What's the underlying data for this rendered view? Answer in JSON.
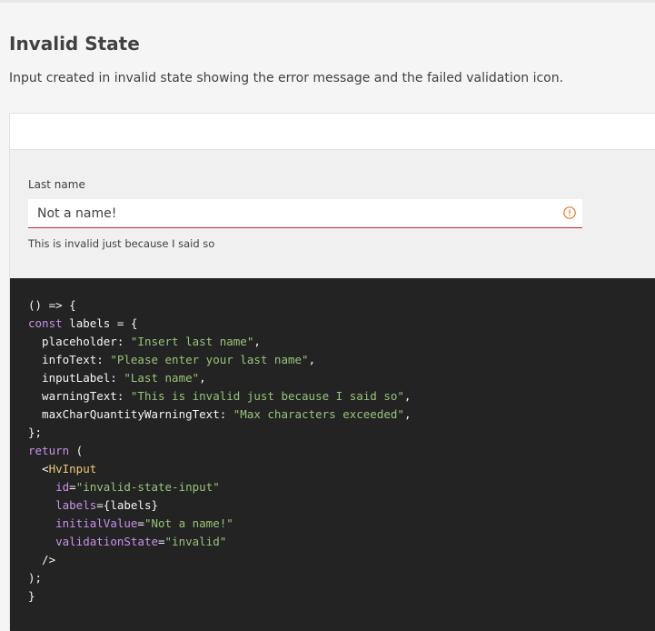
{
  "section": {
    "title": "Invalid State",
    "description": "Input created in invalid state showing the error message and the failed validation icon."
  },
  "input": {
    "label": "Last name",
    "value": "Not a name!",
    "helper_text": "This is invalid just because I said so",
    "status_icon": "warning-circle-icon",
    "error_color": "#c62828"
  },
  "code": {
    "lines": [
      "() => {",
      "const labels = {",
      "  placeholder: \"Insert last name\",",
      "  infoText: \"Please enter your last name\",",
      "  inputLabel: \"Last name\",",
      "  warningText: \"This is invalid just because I said so\",",
      "  maxCharQuantityWarningText: \"Max characters exceeded\",",
      "};",
      "return (",
      "  <HvInput",
      "    id=\"invalid-state-input\"",
      "    labels={labels}",
      "    initialValue=\"Not a name!\"",
      "    validationState=\"invalid\"",
      "  />",
      ");",
      "}"
    ]
  }
}
